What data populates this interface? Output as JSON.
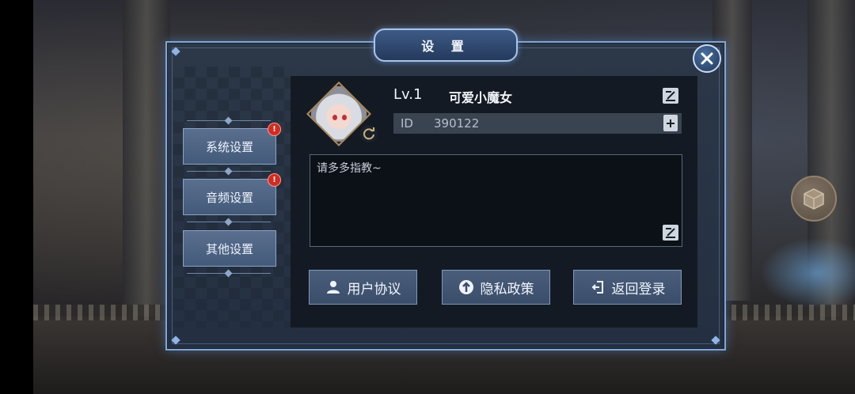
{
  "dialog": {
    "title": "设 置",
    "close_icon": "close-icon"
  },
  "sidebar": {
    "items": [
      {
        "label": "系统设置",
        "badge": "!"
      },
      {
        "label": "音频设置",
        "badge": "!"
      },
      {
        "label": "其他设置"
      }
    ]
  },
  "profile": {
    "level": "Lv.1",
    "nickname": "可爱小魔女",
    "id_label": "ID",
    "id_value": "390122",
    "signature": "请多多指教~"
  },
  "actions": {
    "user_agreement": "用户协议",
    "privacy_policy": "隐私政策",
    "back_to_login": "返回登录"
  },
  "colors": {
    "panel_border": "#7fa6d6",
    "badge": "#d22b23",
    "button": "#4a5e7c"
  }
}
